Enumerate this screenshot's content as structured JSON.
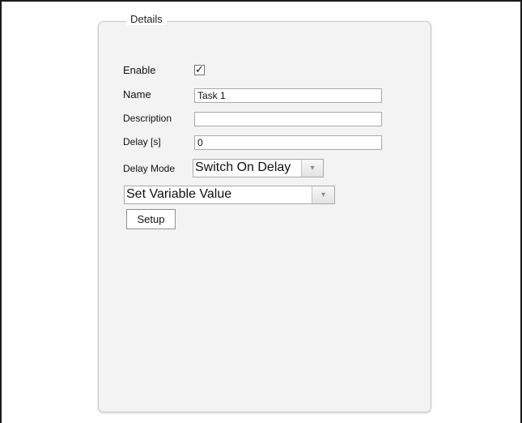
{
  "group": {
    "title": "Details"
  },
  "form": {
    "enable_label": "Enable",
    "enable_checked": true,
    "checkmark": "✓",
    "name_label": "Name",
    "name_value": "Task 1",
    "description_label": "Description",
    "description_value": "",
    "delay_label": "Delay [s]",
    "delay_value": "0",
    "delay_mode_label": "Delay Mode",
    "delay_mode_value": "Switch On Delay",
    "action_value": "Set Variable Value",
    "setup_label": "Setup"
  },
  "icons": {
    "dropdown_arrow": "▾"
  }
}
